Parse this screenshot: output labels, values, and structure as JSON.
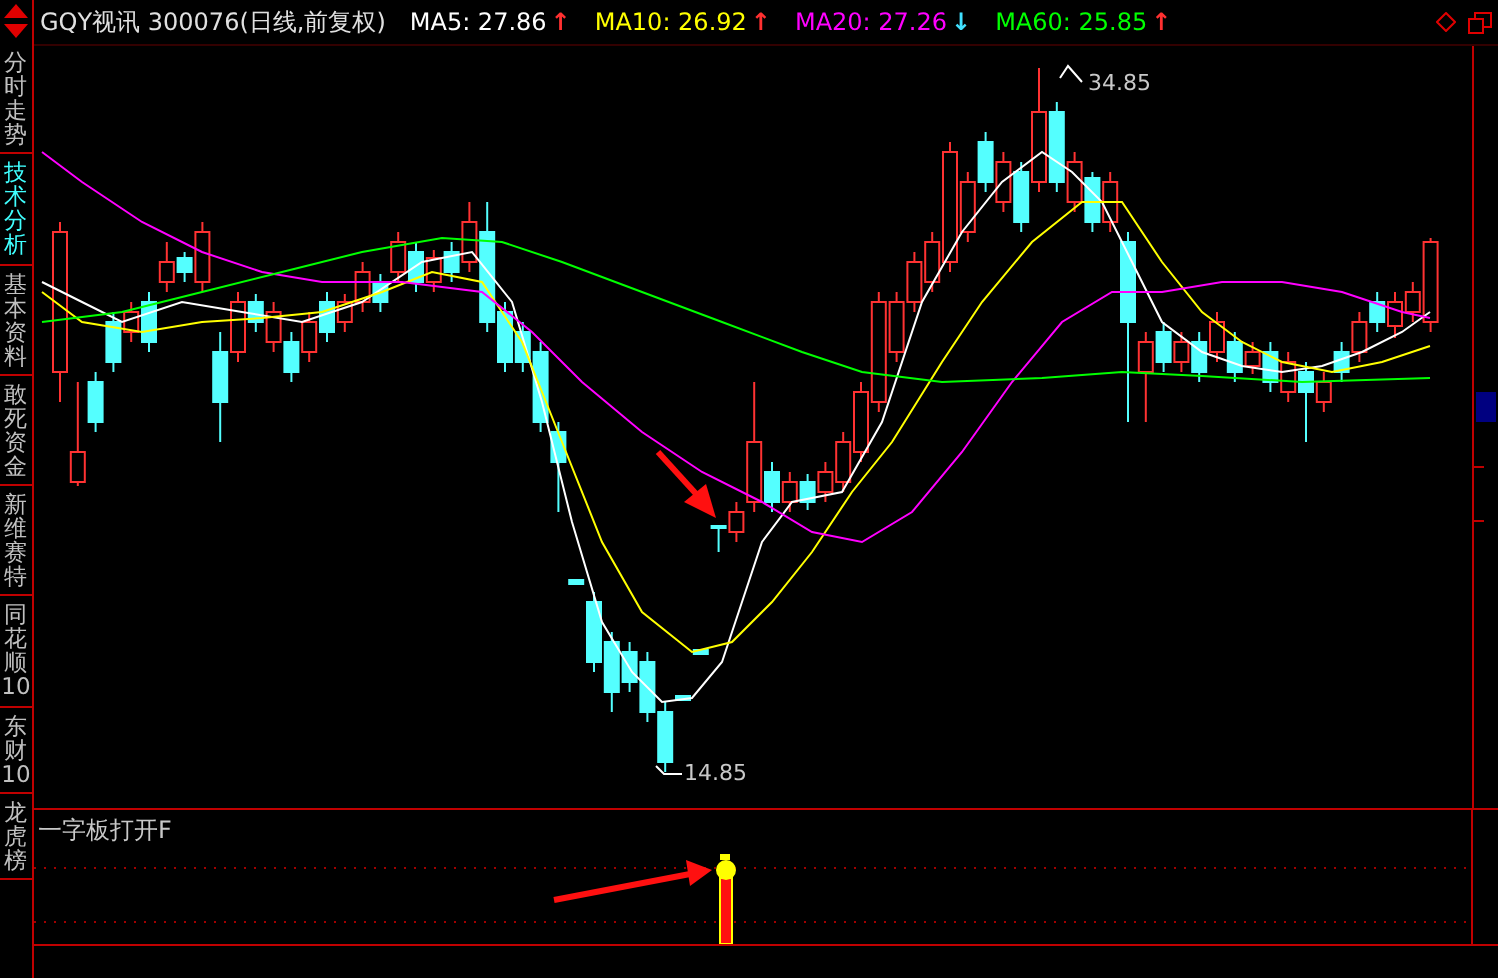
{
  "header": {
    "title": "GQY视讯 300076(日线,前复权)",
    "averages": [
      {
        "label": "MA5: 27.86",
        "color": "#ffffff",
        "arrow": {
          "text": "↑",
          "color": "#ff3030"
        }
      },
      {
        "label": "MA10: 26.92",
        "color": "#ffff00",
        "arrow": {
          "text": "↑",
          "color": "#ff3030"
        }
      },
      {
        "label": "MA20: 27.26",
        "color": "#ff00ff",
        "arrow": {
          "text": "↓",
          "color": "#40e0ff"
        }
      },
      {
        "label": "MA60: 25.85",
        "color": "#00ff00",
        "arrow": {
          "text": "↑",
          "color": "#ff3030"
        }
      }
    ]
  },
  "sidebar": {
    "tabs": [
      {
        "label": "分时走势",
        "selected": false
      },
      {
        "label": "技术分析",
        "selected": true
      },
      {
        "label": "基本资料",
        "selected": false
      },
      {
        "label": "敢死资金",
        "selected": false
      },
      {
        "label": "新维赛特",
        "selected": false
      },
      {
        "label": "同花顺10",
        "selected": false
      },
      {
        "label": "东财10",
        "selected": false
      },
      {
        "label": "龙虎榜",
        "selected": false
      }
    ]
  },
  "price_chart": {
    "high_label": "34.85",
    "low_label": "14.85"
  },
  "indicator_panel": {
    "title": "一字板打开F"
  }
}
